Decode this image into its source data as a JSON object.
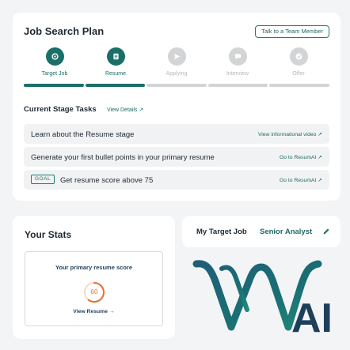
{
  "plan": {
    "title": "Job Search Plan",
    "talk_button": "Talk to a Team Member",
    "steps": [
      {
        "label": "Target Job",
        "icon": "target-icon",
        "state": "active"
      },
      {
        "label": "Resume",
        "icon": "document-icon",
        "state": "active"
      },
      {
        "label": "Applying",
        "icon": "send-icon",
        "state": "inactive"
      },
      {
        "label": "Interview",
        "icon": "chat-icon",
        "state": "inactive"
      },
      {
        "label": "Offer",
        "icon": "check-badge-icon",
        "state": "inactive"
      }
    ],
    "progress_done_segments": 2,
    "progress_total_segments": 5,
    "tasks_heading": "Current Stage Tasks",
    "view_details": "View Details ↗",
    "tasks": [
      {
        "text": "Learn about the Resume stage",
        "link": "View informational video ↗"
      },
      {
        "text": "Generate your first bullet points in your primary resume",
        "link": "Go to ResumAI ↗"
      },
      {
        "badge": "GOAL",
        "text": "Get resume score above 75",
        "link": "Go to ResumAI ↗"
      }
    ]
  },
  "stats": {
    "title": "Your Stats",
    "score_label": "Your primary resume score",
    "score": "60",
    "score_fraction": 0.6,
    "view_resume": "View Resume →"
  },
  "target_job": {
    "title": "My Target Job",
    "value": "Senior Analyst"
  },
  "logo": {
    "text": "AI"
  },
  "colors": {
    "accent": "#1b6f69",
    "inactive": "#d2d4d6",
    "score": "#e4712f",
    "navy": "#1f3f5b"
  }
}
